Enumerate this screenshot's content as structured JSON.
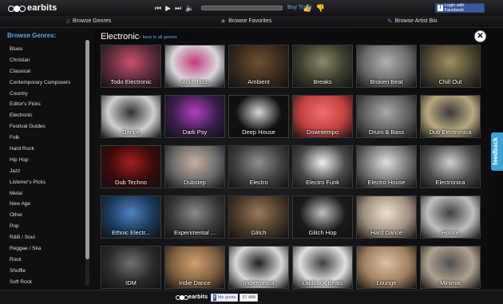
{
  "brand": {
    "name": "earbits"
  },
  "player": {
    "buy_track_label": "Buy Track"
  },
  "facebook_login": {
    "label": "Login with Facebook"
  },
  "nav": {
    "browse_genres": "Browse Genres",
    "browse_favorites": "Browse Favorites",
    "browse_artist_bio": "Browse Artist Bio"
  },
  "sidebar": {
    "title": "Browse Genres:",
    "genres": [
      "Blues",
      "Christian",
      "Classical",
      "Contemporary Composers",
      "Country",
      "Editor's Picks",
      "Electronic",
      "Festival Guides",
      "Folk",
      "Hard Rock",
      "Hip Hop",
      "Jazz",
      "Listener's Picks",
      "Metal",
      "New Age",
      "Other",
      "Pop",
      "R&B / Soul",
      "Reggae / Ska",
      "Rock",
      "Shuffle",
      "Soft Rock"
    ]
  },
  "main": {
    "title": "Electronic",
    "back_link": "« back to all genres",
    "tiles": [
      {
        "label": "Todo Electronic",
        "bg": "#5a2a3c",
        "fg": "#c8526a"
      },
      {
        "label": "Acid Jazz",
        "bg": "#d8d8dc",
        "fg": "#c43a7a"
      },
      {
        "label": "Ambient",
        "bg": "#3a2a1c",
        "fg": "#6e5230"
      },
      {
        "label": "Breaks",
        "bg": "#3c3c2e",
        "fg": "#8a8a6a"
      },
      {
        "label": "Broken Beat",
        "bg": "#6a6a6a",
        "fg": "#b0b0b0"
      },
      {
        "label": "Chill Out",
        "bg": "#4a4630",
        "fg": "#a09060"
      },
      {
        "label": "Dance",
        "bg": "#d0d0d0",
        "fg": "#303030"
      },
      {
        "label": "Dark Psy",
        "bg": "#3a1e4a",
        "fg": "#b040c0"
      },
      {
        "label": "Deep House",
        "bg": "#101010",
        "fg": "#d8d8d8"
      },
      {
        "label": "Downtempo",
        "bg": "#c04040",
        "fg": "#f07070"
      },
      {
        "label": "Drum & Bass",
        "bg": "#5e5e5e",
        "fg": "#a8a8a8"
      },
      {
        "label": "Dub Electronica",
        "bg": "#b8a880",
        "fg": "#3a3a3a"
      },
      {
        "label": "Dub Techno",
        "bg": "#3a0a0a",
        "fg": "#a02020"
      },
      {
        "label": "Dubstep",
        "bg": "#6a6a6a",
        "fg": "#c8b0a0"
      },
      {
        "label": "Electro",
        "bg": "#404040",
        "fg": "#909090"
      },
      {
        "label": "Electro Funk",
        "bg": "#4a4a4a",
        "fg": "#f0f0f0"
      },
      {
        "label": "Electro House",
        "bg": "#707070",
        "fg": "#e0e0e0"
      },
      {
        "label": "Electronica",
        "bg": "#505050",
        "fg": "#d0d0d0"
      },
      {
        "label": "Ethnic Electr...",
        "bg": "#1a3a5a",
        "fg": "#5080c0"
      },
      {
        "label": "Experimental ...",
        "bg": "#3a3a3a",
        "fg": "#8a8a8a"
      },
      {
        "label": "Glitch",
        "bg": "#4a3a2a",
        "fg": "#9a7a5a"
      },
      {
        "label": "Glitch Hop",
        "bg": "#1a1a1a",
        "fg": "#c0c0c0"
      },
      {
        "label": "Hard Dance",
        "bg": "#a09080",
        "fg": "#f0e0d0"
      },
      {
        "label": "House",
        "bg": "#c0c0c0",
        "fg": "#404040"
      },
      {
        "label": "IDM",
        "bg": "#2a2a2a",
        "fg": "#707070"
      },
      {
        "label": "Indie Dance",
        "bg": "#806040",
        "fg": "#d0a070"
      },
      {
        "label": "Indietronica",
        "bg": "#d8d8d8",
        "fg": "#202020"
      },
      {
        "label": "Laidback Beats",
        "bg": "#e0e0e0",
        "fg": "#404040"
      },
      {
        "label": "Lounge",
        "bg": "#a08060",
        "fg": "#e0c0a0"
      },
      {
        "label": "Minimal",
        "bg": "#b0a090",
        "fg": "#505050"
      }
    ]
  },
  "feedback": {
    "label": "feedback"
  },
  "footer": {
    "like_label": "Me gusta",
    "like_count": "37,499"
  },
  "colors": {
    "accent": "#5aa8e8",
    "facebook": "#3b5998",
    "feedback": "#3aa3d8"
  }
}
